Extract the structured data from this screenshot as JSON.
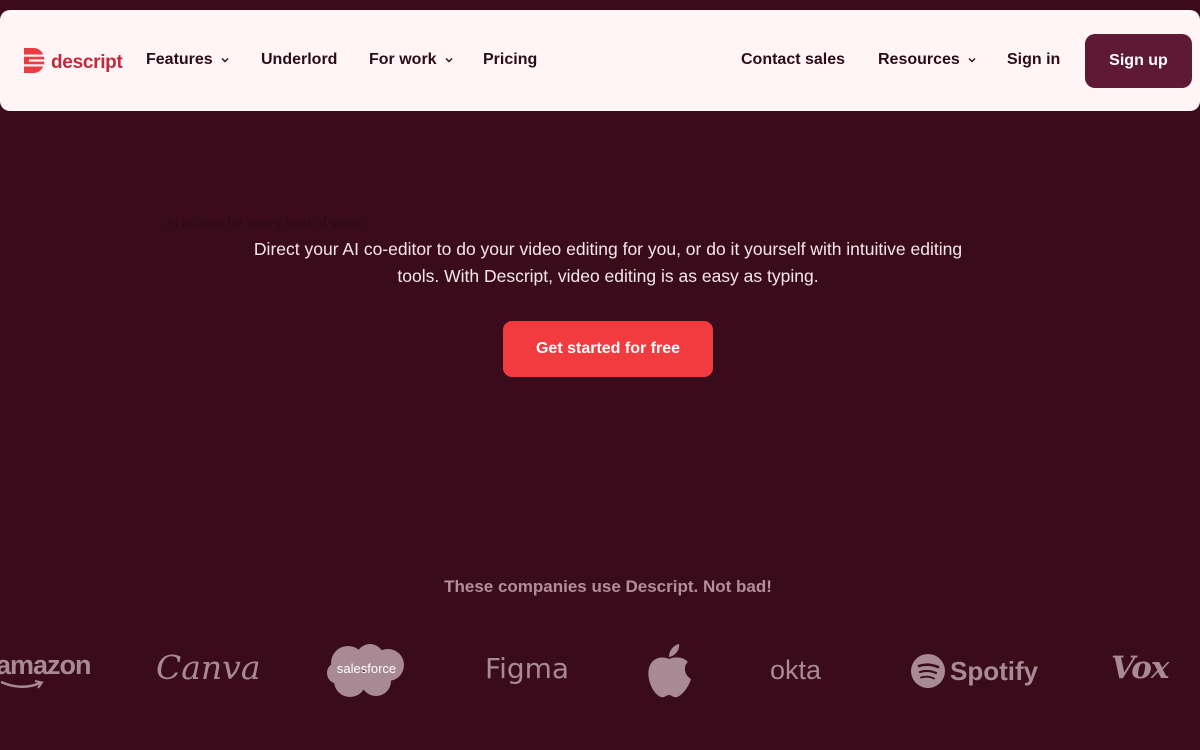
{
  "nav": {
    "brand": "descript",
    "items": [
      {
        "label": "Features",
        "dropdown": true
      },
      {
        "label": "Underlord",
        "dropdown": false
      },
      {
        "label": "For work",
        "dropdown": true
      },
      {
        "label": "Pricing",
        "dropdown": false
      }
    ],
    "right_items": [
      {
        "label": "Contact sales",
        "dropdown": false
      },
      {
        "label": "Resources",
        "dropdown": true
      },
      {
        "label": "Sign in",
        "dropdown": false
      }
    ],
    "signup_label": "Sign up"
  },
  "hero": {
    "faint_line": "AI editing for every kind of video",
    "description": "Direct your AI co-editor to do your video editing for you, or do it yourself with intuitive editing tools. With Descript, video editing is as easy as typing.",
    "cta_label": "Get started for free"
  },
  "companies": {
    "heading": "These companies use Descript. Not bad!",
    "logos": [
      {
        "name": "amazon",
        "text": "amazon"
      },
      {
        "name": "canva",
        "text": "Canva"
      },
      {
        "name": "salesforce",
        "text": "salesforce"
      },
      {
        "name": "figma",
        "text": "Figma"
      },
      {
        "name": "apple",
        "text": ""
      },
      {
        "name": "okta",
        "text": "okta"
      },
      {
        "name": "spotify",
        "text": "Spotify"
      },
      {
        "name": "vox",
        "text": "Vox"
      }
    ]
  },
  "colors": {
    "background": "#3a0c1b",
    "nav_background": "#fff5f7",
    "brand": "#c22a3c",
    "signup": "#5e1a34",
    "cta": "#f23b3f",
    "logo_gray": "#a88a94"
  },
  "icons": {
    "brand_logo": "descript-logo-icon",
    "dropdown": "chevron-down-icon",
    "apple": "apple-logo-icon",
    "spotify": "spotify-logo-icon",
    "salesforce": "salesforce-cloud-icon"
  }
}
